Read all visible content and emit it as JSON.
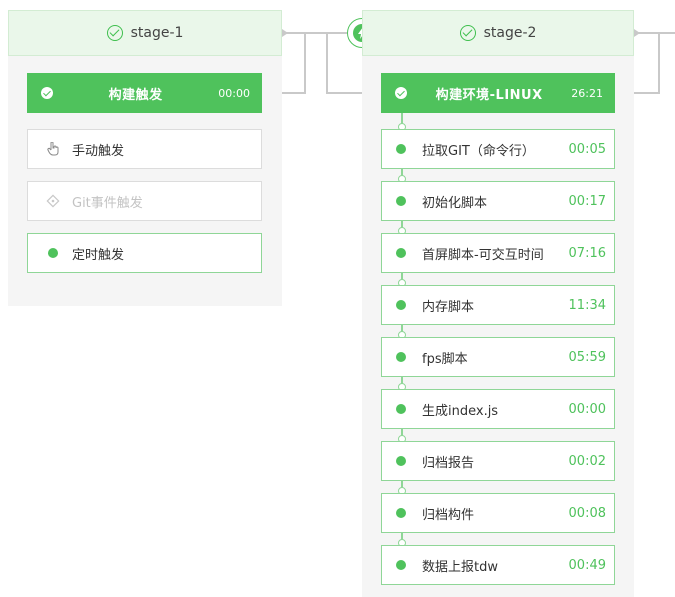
{
  "stage1": {
    "title": "stage-1",
    "job": {
      "label": "构建触发",
      "time": "00:00"
    },
    "triggers": [
      {
        "label": "手动触发",
        "icon": "hand-pointer-icon",
        "state": "normal"
      },
      {
        "label": "Git事件触发",
        "icon": "git-icon",
        "state": "disabled"
      },
      {
        "label": "定时触发",
        "icon": "green-dot",
        "state": "active"
      }
    ]
  },
  "stage2": {
    "title": "stage-2",
    "job": {
      "label": "构建环境-LINUX",
      "time": "26:21"
    },
    "tasks": [
      {
        "label": "拉取GIT（命令行）",
        "time": "00:05"
      },
      {
        "label": "初始化脚本",
        "time": "00:17"
      },
      {
        "label": "首屏脚本-可交互时间",
        "time": "07:16"
      },
      {
        "label": "内存脚本",
        "time": "11:34"
      },
      {
        "label": "fps脚本",
        "time": "05:59"
      },
      {
        "label": "生成index.js",
        "time": "00:00"
      },
      {
        "label": "归档报告",
        "time": "00:02"
      },
      {
        "label": "归档构件",
        "time": "00:08"
      },
      {
        "label": "数据上报tdw",
        "time": "00:49"
      }
    ]
  },
  "colors": {
    "accent": "#4fc25c",
    "border_green": "#8fd697",
    "header_bg": "#eaf7ea"
  }
}
